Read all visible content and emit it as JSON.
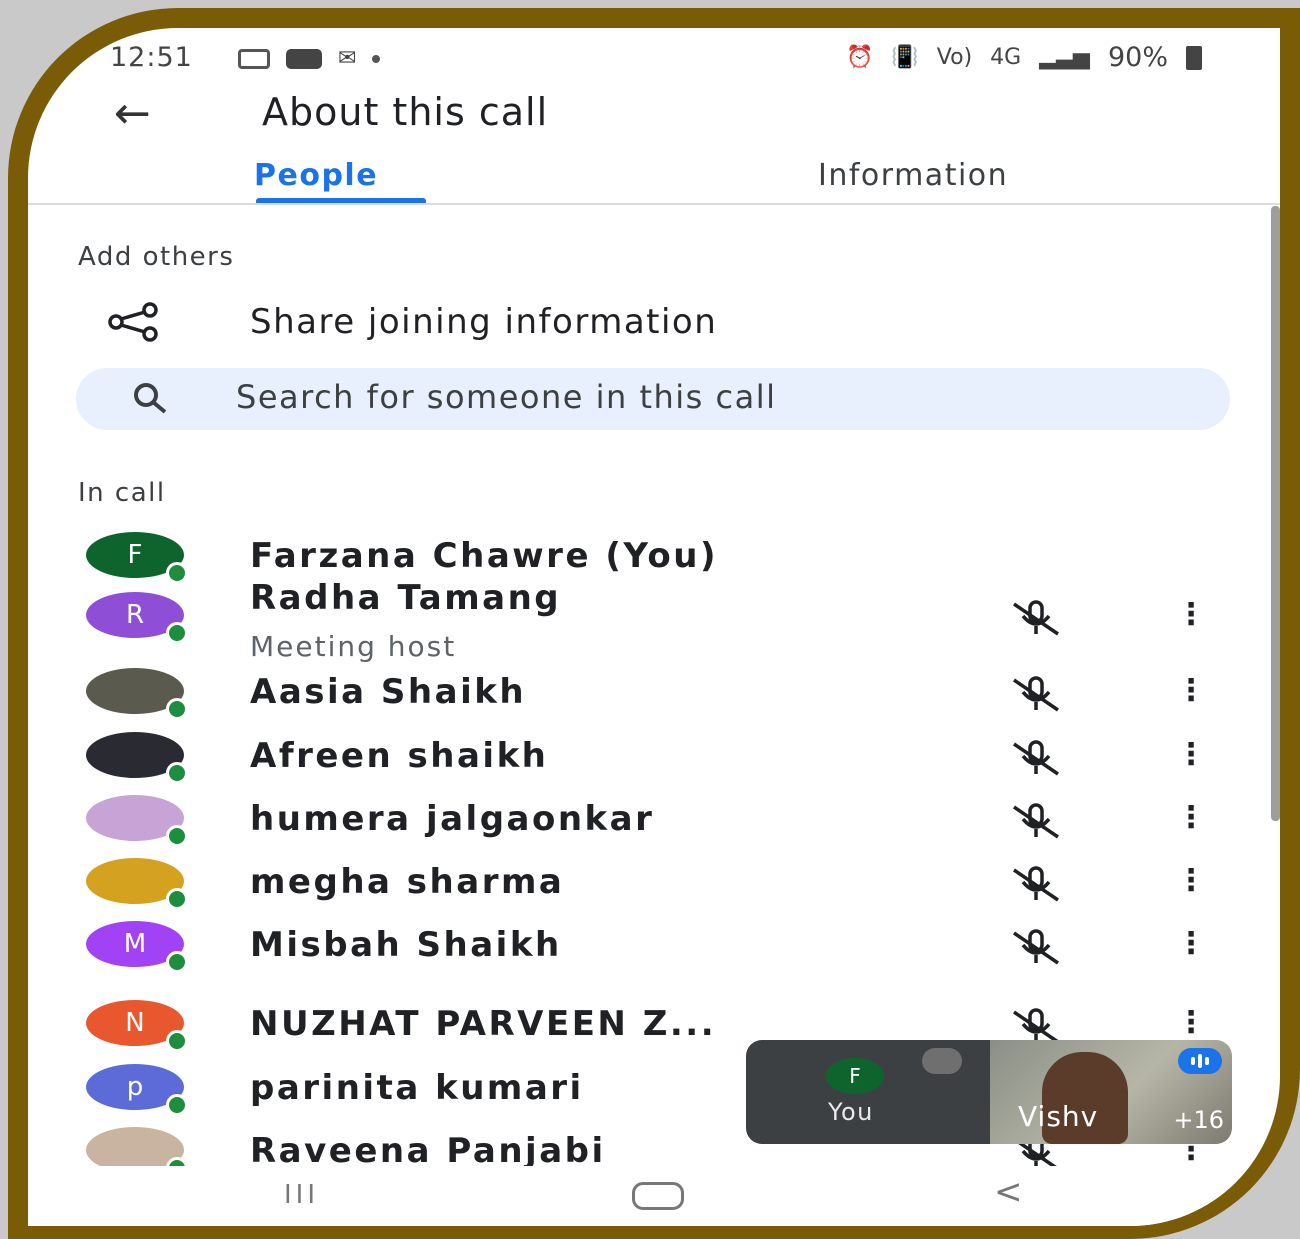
{
  "status_bar": {
    "time": "12:51",
    "battery": "90%",
    "left_icons": [
      "gallery-icon",
      "youtube-icon",
      "gmail-icon",
      "dot-icon"
    ],
    "right_icons": [
      "alarm-icon",
      "vibrate-icon",
      "volte-icon",
      "4g-icon",
      "signal-icon",
      "battery-icon"
    ],
    "network_1": "Vo)",
    "network_2": "4G"
  },
  "header": {
    "back_icon": "arrow-left-icon",
    "title": "About this call"
  },
  "tabs": [
    {
      "label": "People",
      "selected": true
    },
    {
      "label": "Information",
      "selected": false
    }
  ],
  "add_others": {
    "section_label": "Add others",
    "share_icon": "share-icon",
    "share_label": "Share joining information",
    "search_icon": "search-icon",
    "search_placeholder": "Search for someone in this call"
  },
  "in_call": {
    "section_label": "In call",
    "participants": [
      {
        "name": "Farzana Chawre (You)",
        "initial": "F",
        "avatar_color": "#0d652d",
        "role": "",
        "muted": false,
        "has_menu": false,
        "photo": false
      },
      {
        "name": "Radha Tamang",
        "initial": "R",
        "avatar_color": "#8e4fd6",
        "role": "Meeting host",
        "muted": true,
        "has_menu": true,
        "photo": false
      },
      {
        "name": "Aasia Shaikh",
        "initial": "",
        "avatar_color": "#5a5a4e",
        "role": "",
        "muted": true,
        "has_menu": true,
        "photo": true
      },
      {
        "name": "Afreen shaikh",
        "initial": "",
        "avatar_color": "#2a2a32",
        "role": "",
        "muted": true,
        "has_menu": true,
        "photo": true
      },
      {
        "name": "humera jalgaonkar",
        "initial": "",
        "avatar_color": "#c7a3d6",
        "role": "",
        "muted": true,
        "has_menu": true,
        "photo": true
      },
      {
        "name": "megha sharma",
        "initial": "",
        "avatar_color": "#d4a21f",
        "role": "",
        "muted": true,
        "has_menu": true,
        "photo": true
      },
      {
        "name": "Misbah Shaikh",
        "initial": "M",
        "avatar_color": "#a142f4",
        "role": "",
        "muted": true,
        "has_menu": true,
        "photo": false
      },
      {
        "name": "NUZHAT PARVEEN Z...",
        "initial": "N",
        "avatar_color": "#e8572d",
        "role": "",
        "muted": true,
        "has_menu": true,
        "photo": false
      },
      {
        "name": "parinita kumari",
        "initial": "p",
        "avatar_color": "#5c6bd8",
        "role": "",
        "muted": true,
        "has_menu": true,
        "photo": false
      },
      {
        "name": "Raveena Panjabi",
        "initial": "",
        "avatar_color": "#c9b3a1",
        "role": "",
        "muted": true,
        "has_menu": true,
        "photo": true
      }
    ]
  },
  "pip": {
    "self_initial": "F",
    "self_label": "You",
    "remote_label": "Vishv",
    "extra_count": "+16"
  },
  "nav_bar": {
    "recents": "III",
    "back": "<"
  },
  "colors": {
    "accent": "#1a73e8",
    "frame": "#7a5c06",
    "online": "#1e8e3e",
    "search_bg": "#e8f0fe"
  }
}
